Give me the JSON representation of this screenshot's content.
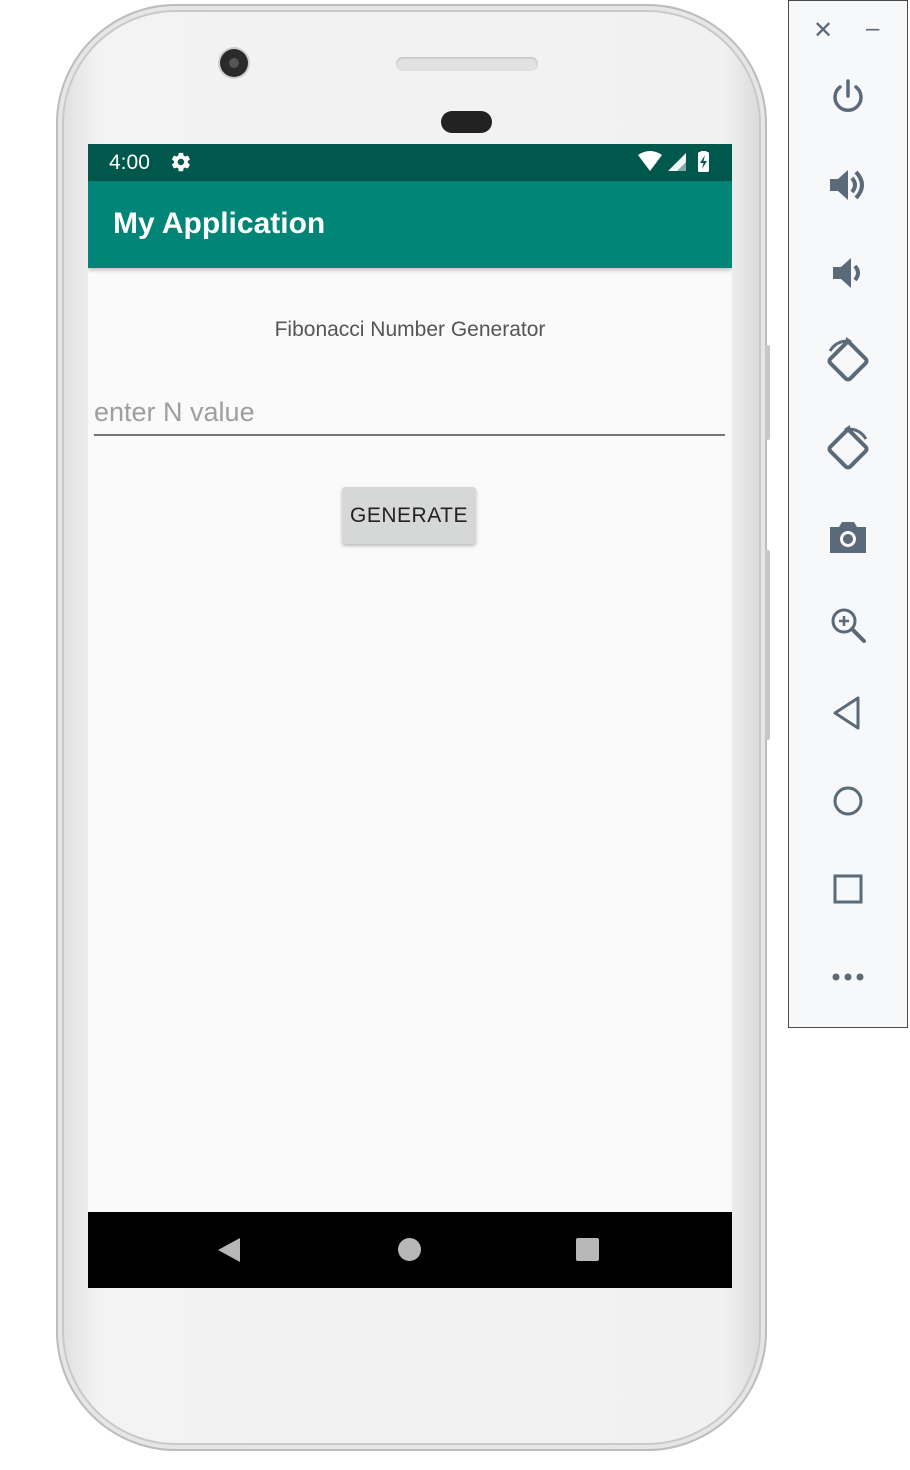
{
  "status_bar": {
    "time": "4:00"
  },
  "app_bar": {
    "title": "My Application"
  },
  "content": {
    "heading": "Fibonacci Number Generator",
    "n_input": {
      "placeholder": "enter N value",
      "value": ""
    },
    "generate_button": "GENERATE"
  },
  "nav_bar": {
    "buttons": [
      "back-icon",
      "home-icon",
      "recents-icon"
    ]
  },
  "emulator_panel": {
    "window_buttons": {
      "close": "✕",
      "minimize": "–"
    },
    "controls": [
      "power-icon",
      "volume-up-icon",
      "volume-down-icon",
      "rotate-left-icon",
      "rotate-right-icon",
      "screenshot-camera-icon",
      "zoom-icon",
      "back-triangle-icon",
      "home-circle-icon",
      "overview-square-icon",
      "more-dots-icon"
    ]
  },
  "colors": {
    "status_bar": "#00574b",
    "app_bar": "#008577",
    "screen_background": "#fafafa",
    "button_background": "#d6d7d7",
    "panel_icon": "#5a6a78"
  }
}
